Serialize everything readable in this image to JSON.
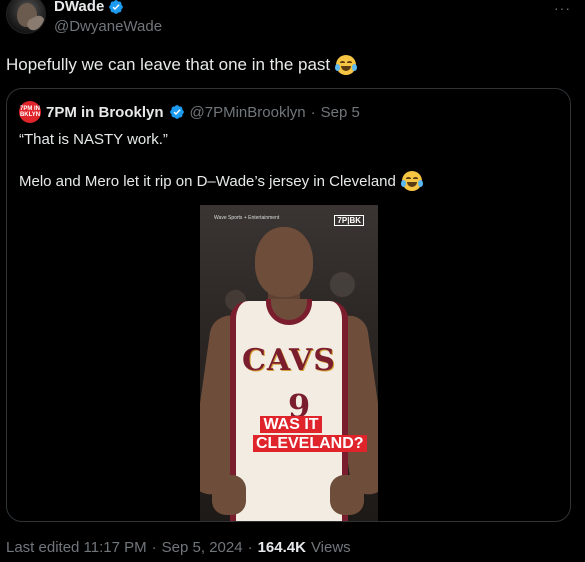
{
  "author": {
    "display_name": "DWade",
    "handle": "@DwyaneWade",
    "verified_icon": "verified-badge-icon"
  },
  "more_icon": "···",
  "tweet": {
    "text": "Hopefully we can leave that one in the past",
    "emoji": "face-with-tears-of-joy"
  },
  "quoted_tweet": {
    "avatar_text": "7PM IN BKLYN",
    "display_name": "7PM in Brooklyn",
    "handle": "@7PMinBrooklyn",
    "separator": "·",
    "date": "Sep 5",
    "line1": "“That is NASTY work.”",
    "line2": "Melo and Mero let it rip on D–Wade’s jersey in Cleveland",
    "line2_emoji": "loudly-crying-face",
    "media": {
      "watermark_left": "Wave Sports + Entertainment",
      "watermark_right": "7P|BK",
      "jersey_text": "CAVS",
      "jersey_number": "9",
      "overlay_line1": "WAS IT",
      "overlay_line2": "CLEVELAND?"
    }
  },
  "footer": {
    "edited": "Last edited 11:17 PM",
    "sep1": "·",
    "date": "Sep 5, 2024",
    "sep2": "·",
    "views_count": "164.4K",
    "views_label": "Views"
  },
  "colors": {
    "background": "#000000",
    "text_primary": "#e7e9ea",
    "text_secondary": "#71767b",
    "verified_blue": "#1d9bf0",
    "border": "#2f3336",
    "brand_red": "#e0242b"
  }
}
